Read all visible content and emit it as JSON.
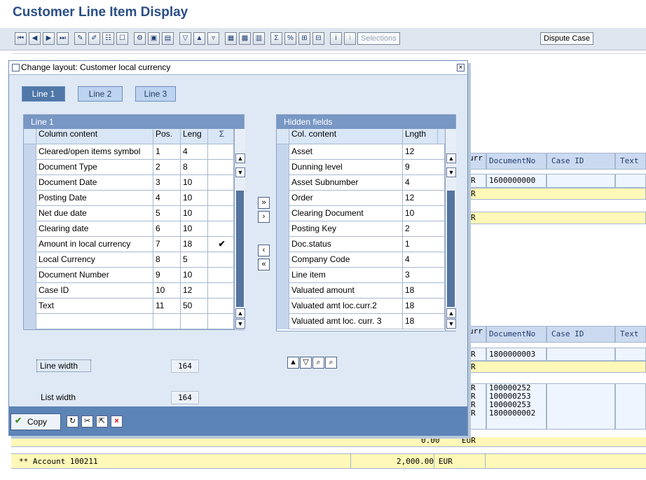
{
  "page": {
    "title": "Customer Line Item Display"
  },
  "toolbar": {
    "selections": "Selections",
    "dispute_case": "Dispute Case"
  },
  "background": {
    "header_cols": [
      "urr",
      "DocumentNo",
      "Case ID",
      "Text"
    ],
    "top_doc": "1600000000",
    "top_curr": [
      "R",
      "R"
    ],
    "mid_curr": "R",
    "bottom_doc": "1800000003",
    "bottom_curr": [
      "R",
      "R"
    ],
    "list_docs": [
      "100000252",
      "100000253",
      "100000253",
      "1800000002"
    ],
    "list_curr": [
      "R",
      "R",
      "R",
      "R"
    ],
    "summary_amount": "0.00",
    "summary_curr": "EUR",
    "account_label": "** Account 100211",
    "account_amount": "2,000.00",
    "account_curr": "EUR"
  },
  "dialog": {
    "title": "Change layout: Customer local currency",
    "tabs": [
      "Line 1",
      "Line 2",
      "Line 3"
    ],
    "left_title": "Line 1",
    "left_headers": [
      "Column content",
      "Pos.",
      "Leng"
    ],
    "left_rows": [
      {
        "content": "Cleared/open items symbol",
        "pos": "1",
        "len": "4",
        "check": ""
      },
      {
        "content": "Document Type",
        "pos": "2",
        "len": "8",
        "check": ""
      },
      {
        "content": "Document Date",
        "pos": "3",
        "len": "10",
        "check": ""
      },
      {
        "content": "Posting Date",
        "pos": "4",
        "len": "10",
        "check": ""
      },
      {
        "content": "Net due date",
        "pos": "5",
        "len": "10",
        "check": ""
      },
      {
        "content": "Clearing date",
        "pos": "6",
        "len": "10",
        "check": ""
      },
      {
        "content": "Amount in local currency",
        "pos": "7",
        "len": "18",
        "check": "✔"
      },
      {
        "content": "Local Currency",
        "pos": "8",
        "len": "5",
        "check": ""
      },
      {
        "content": "Document Number",
        "pos": "9",
        "len": "10",
        "check": ""
      },
      {
        "content": "Case ID",
        "pos": "10",
        "len": "12",
        "check": ""
      },
      {
        "content": "Text",
        "pos": "11",
        "len": "50",
        "check": ""
      },
      {
        "content": "",
        "pos": "",
        "len": "",
        "check": ""
      }
    ],
    "right_title": "Hidden fields",
    "right_headers": [
      "Col. content",
      "Lngth"
    ],
    "right_rows": [
      {
        "content": "Asset",
        "len": "12"
      },
      {
        "content": "Dunning level",
        "len": "9"
      },
      {
        "content": "Asset Subnumber",
        "len": "4"
      },
      {
        "content": "Order",
        "len": "12"
      },
      {
        "content": "Clearing Document",
        "len": "10"
      },
      {
        "content": "Posting Key",
        "len": "2"
      },
      {
        "content": "Doc.status",
        "len": "1"
      },
      {
        "content": "Company Code",
        "len": "4"
      },
      {
        "content": "Line item",
        "len": "3"
      },
      {
        "content": "Valuated amount",
        "len": "18"
      },
      {
        "content": "Valuated amt loc.curr.2",
        "len": "18"
      },
      {
        "content": "Valuated amt loc. curr. 3",
        "len": "18"
      }
    ],
    "line_width_label": "Line width",
    "line_width": "164",
    "list_width_label": "List width",
    "list_width": "164",
    "copy_label": "Copy"
  }
}
